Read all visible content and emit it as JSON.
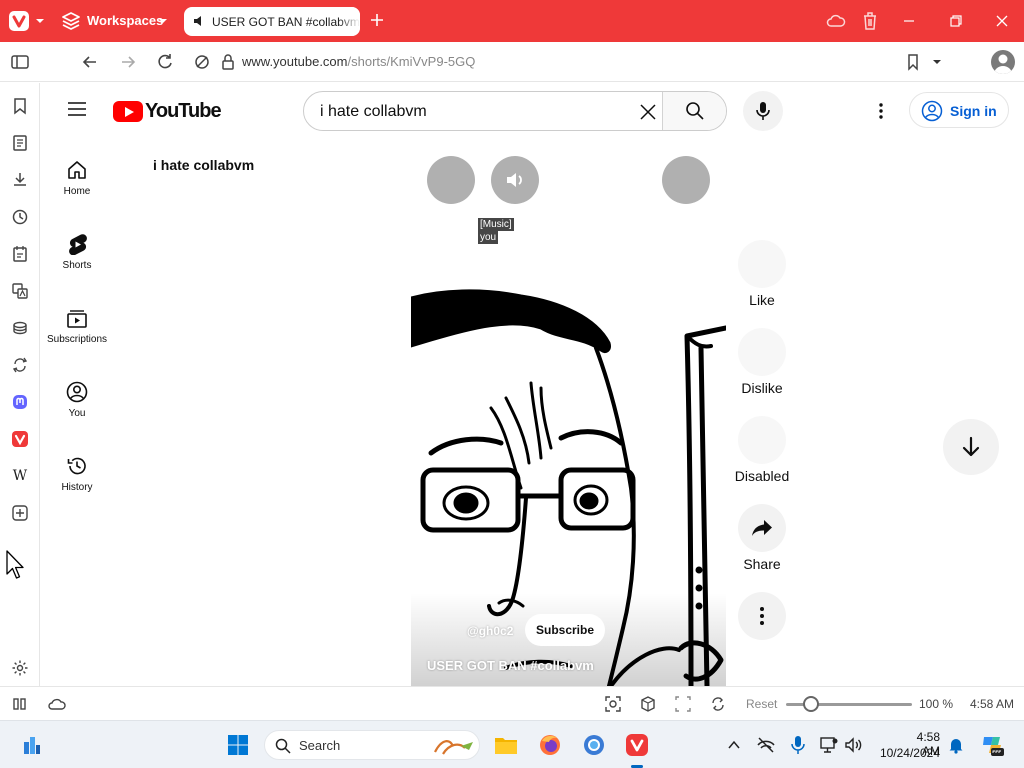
{
  "browser": {
    "workspaces_label": "Workspaces",
    "tab_title": "USER GOT BAN #collabvm",
    "url_host": "www.youtube.com",
    "url_path": "/shorts/KmiVvP9-5GQ"
  },
  "youtube": {
    "logo_text": "YouTube",
    "search_query": "i hate collabvm",
    "sign_in_label": "Sign in",
    "query_heading": "i hate collabvm",
    "guide": [
      {
        "label": "Home",
        "icon": "home-icon"
      },
      {
        "label": "Shorts",
        "icon": "shorts-icon"
      },
      {
        "label": "Subscriptions",
        "icon": "subscriptions-icon"
      },
      {
        "label": "You",
        "icon": "you-icon"
      },
      {
        "label": "History",
        "icon": "history-icon"
      }
    ],
    "short": {
      "caption_line1": "[Music]",
      "caption_line2": "you",
      "channel": "@gh0c2",
      "subscribe_label": "Subscribe",
      "title": "USER GOT BAN #collabvm"
    },
    "actions": [
      {
        "label": "Like",
        "icon": "like-icon"
      },
      {
        "label": "Dislike",
        "icon": "dislike-icon"
      },
      {
        "label": "Disabled",
        "icon": "comments-icon"
      },
      {
        "label": "Share",
        "icon": "share-icon"
      },
      {
        "label": "",
        "icon": "more-icon"
      }
    ]
  },
  "status_bar": {
    "reset_label": "Reset",
    "zoom": "100 %",
    "zoom_level": 1.0,
    "clock": "4:58 AM"
  },
  "taskbar": {
    "search_placeholder": "Search",
    "time": "4:58 AM",
    "date": "10/24/2024"
  },
  "colors": {
    "vivaldi_red": "#ef3939",
    "youtube_red": "#ff0000",
    "link_blue": "#065fd4"
  }
}
